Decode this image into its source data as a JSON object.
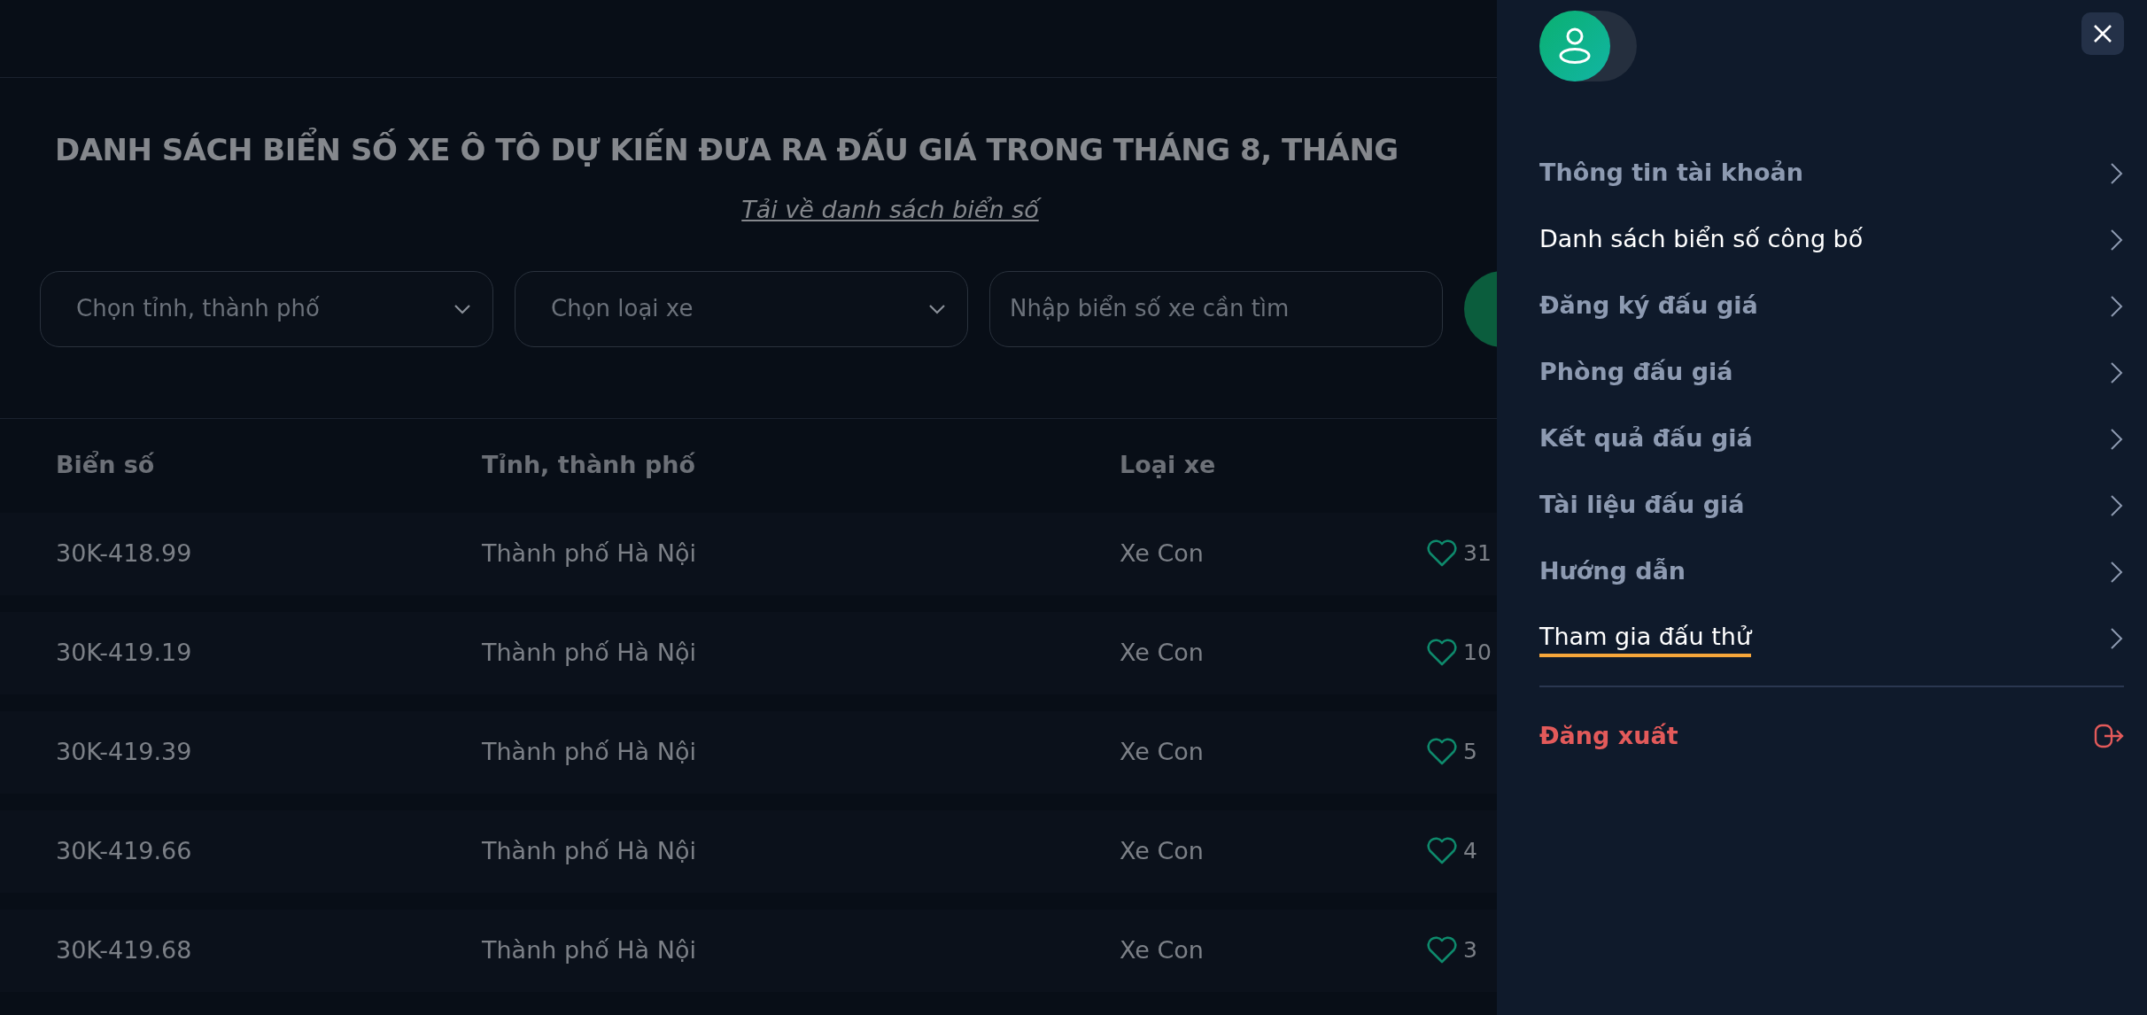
{
  "page": {
    "title": "DANH SÁCH BIỂN SỐ XE Ô TÔ DỰ KIẾN ĐƯA RA ĐẤU GIÁ TRONG THÁNG 8, THÁNG",
    "download_link": "Tải về danh sách biển số"
  },
  "filters": [
    {
      "kind": "select",
      "placeholder": "Chọn tỉnh, thành phố"
    },
    {
      "kind": "select",
      "placeholder": "Chọn loại xe"
    },
    {
      "kind": "text",
      "placeholder": "Nhập biển số xe cần tìm"
    }
  ],
  "table": {
    "columns": [
      "Biển số",
      "Tỉnh, thành phố",
      "Loại xe"
    ],
    "rows": [
      {
        "plate": "30K-418.99",
        "province": "Thành phố Hà Nội",
        "type": "Xe Con",
        "likes": "31"
      },
      {
        "plate": "30K-419.19",
        "province": "Thành phố Hà Nội",
        "type": "Xe Con",
        "likes": "10"
      },
      {
        "plate": "30K-419.39",
        "province": "Thành phố Hà Nội",
        "type": "Xe Con",
        "likes": "5"
      },
      {
        "plate": "30K-419.66",
        "province": "Thành phố Hà Nội",
        "type": "Xe Con",
        "likes": "4"
      },
      {
        "plate": "30K-419.68",
        "province": "Thành phố Hà Nội",
        "type": "Xe Con",
        "likes": "3"
      }
    ]
  },
  "drawer": {
    "menu": [
      {
        "label": "Thông tin tài khoản",
        "selected": false,
        "kind": "plain"
      },
      {
        "label": "Danh sách biển số công bố",
        "selected": true,
        "kind": "plain"
      },
      {
        "label": "Đăng ký đấu giá",
        "selected": false,
        "kind": "plain"
      },
      {
        "label": "Phòng đấu giá",
        "selected": false,
        "kind": "plain"
      },
      {
        "label": "Kết quả đấu giá",
        "selected": false,
        "kind": "plain"
      },
      {
        "label": "Tài liệu đấu giá",
        "selected": false,
        "kind": "plain"
      },
      {
        "label": "Hướng dẫn",
        "selected": false,
        "kind": "plain"
      },
      {
        "label": "Tham gia đấu thử",
        "selected": false,
        "kind": "fire"
      }
    ],
    "logout": "Đăng xuất"
  }
}
